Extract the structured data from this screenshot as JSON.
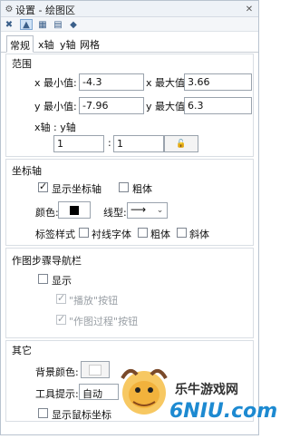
{
  "window": {
    "title": "设置 - 绘图区",
    "title_icon": "gear-icon"
  },
  "titlebar_buttons": [
    "close-icon"
  ],
  "toolbar": {
    "tools": [
      "close-icon",
      "chart-icon",
      "layout-icon",
      "grid-icon",
      "palette-icon"
    ]
  },
  "tabs": [
    {
      "label": "常规",
      "active": true
    },
    {
      "label": "x轴"
    },
    {
      "label": "y轴"
    },
    {
      "label": "网格"
    }
  ],
  "range": {
    "title": "范围",
    "x_min_label": "x 最小值:",
    "x_min": "-4.3",
    "x_max_label": "x 最大值:",
    "x_max": "3.66",
    "y_min_label": "y 最小值:",
    "y_min": "-7.96",
    "y_max_label": "y 最大值:",
    "y_max": "6.3",
    "ratio_label": "x轴 : y轴",
    "ratio_x": "1",
    "ratio_sep": ":",
    "ratio_y": "1",
    "lock_icon": "lock-icon"
  },
  "axes": {
    "title": "坐标轴",
    "show_axes_label": "显示坐标轴",
    "show_axes_checked": true,
    "bold_label": "粗体",
    "bold_checked": false,
    "color_label": "颜色:",
    "color_value": "#000000",
    "linetype_label": "线型:",
    "linetype_value": "⟶",
    "label_style_label": "标签样式",
    "serif_label": "衬线字体",
    "bold2_label": "粗体",
    "italic_label": "斜体"
  },
  "nav": {
    "title": "作图步骤导航栏",
    "show_label": "显示",
    "show_checked": false,
    "play_label": "\"播放\"按钮",
    "play_checked": true,
    "process_label": "\"作图过程\"按钮",
    "process_checked": true
  },
  "other": {
    "title": "其它",
    "bg_color_label": "背景颜色:",
    "bg_color_value": "#ffffff",
    "tooltip_label": "工具提示:",
    "tooltip_value": "自动",
    "show_cursor_label": "显示鼠标坐标",
    "show_cursor_checked": false
  },
  "watermark": {
    "brand": "乐牛游戏网",
    "logo_text": "6NIU.com"
  }
}
